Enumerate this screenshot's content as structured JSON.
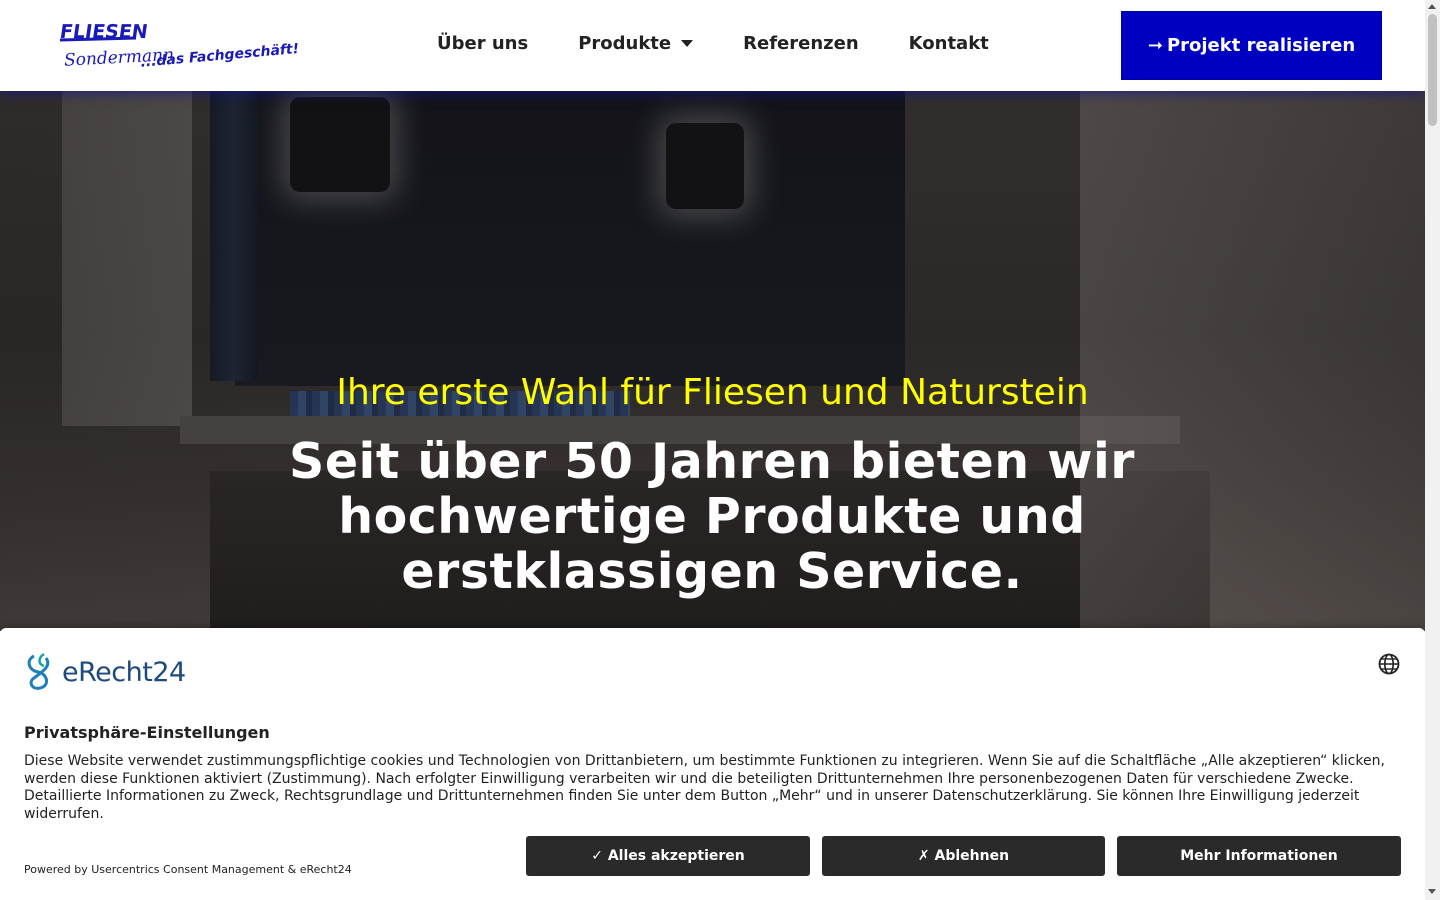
{
  "header": {
    "logo": {
      "line1": "FLIESEN",
      "line2": "Sondermann",
      "tagline": "...das Fachgeschäft!"
    },
    "nav": [
      {
        "label": "Über uns"
      },
      {
        "label": "Produkte",
        "has_dropdown": true
      },
      {
        "label": "Referenzen"
      },
      {
        "label": "Kontakt"
      }
    ],
    "cta": {
      "icon": "arrow-right-icon",
      "arrow": "➞",
      "label": "Projekt realisieren"
    }
  },
  "hero": {
    "subtitle": "Ihre erste Wahl für Fliesen und Naturstein",
    "title": "Seit über 50 Jahren bieten wir hochwertige Produkte und erstklassigen Service."
  },
  "consent": {
    "brand": "eRecht24",
    "heading": "Privatsphäre-Einstellungen",
    "text": "Diese Website verwendet zustimmungspflichtige cookies und Technologien von Drittanbietern, um bestimmte Funktionen zu integrieren. Wenn Sie auf die Schaltfläche „Alle akzeptieren“ klicken, werden diese Funktionen aktiviert (Zustimmung). Nach erfolgter Einwilligung verarbeiten wir und die beteiligten Drittunternehmen Ihre personenbezogenen Daten für verschiedene Zwecke. Detaillierte Informationen zu Zweck, Rechtsgrundlage und Drittunternehmen finden Sie unter dem Button „Mehr“ und in unserer Datenschutzerklärung. Sie können Ihre Einwilligung jederzeit widerrufen.",
    "powered_by": "Powered by Usercentrics Consent Management & eRecht24",
    "buttons": {
      "accept": "✓ Alles akzeptieren",
      "decline": "✗ Ablehnen",
      "more": "Mehr Informationen"
    }
  },
  "colors": {
    "brand_blue": "#0000c2",
    "hero_subtitle": "#ffff00",
    "button_dark": "#2a2a2a"
  }
}
